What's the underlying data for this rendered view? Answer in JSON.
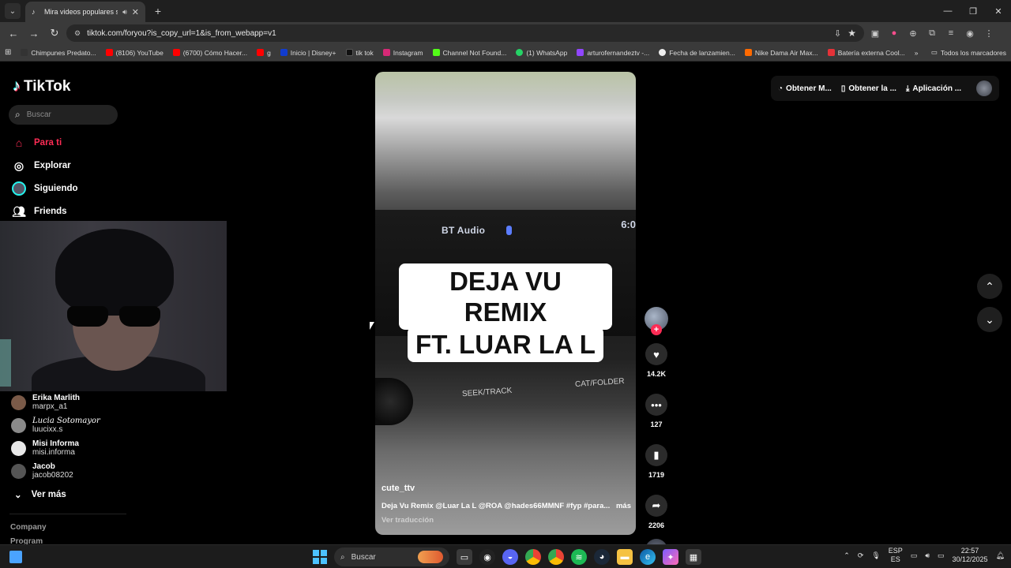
{
  "browser": {
    "tab": {
      "title": "Mira videos populares selec",
      "favicon": "tiktok-icon",
      "sound_icon": "speaker-icon"
    },
    "address": {
      "url": "tiktok.com/foryou?is_copy_url=1&is_from_webapp=v1"
    },
    "bookmarks": [
      {
        "label": "Chimpunes Predato...",
        "color": "#333333"
      },
      {
        "label": "(8106) YouTube",
        "color": "#ff0000"
      },
      {
        "label": "(6700) Cómo Hacer...",
        "color": "#ff0000"
      },
      {
        "label": "g",
        "color": "#ff0000"
      },
      {
        "label": "Inicio | Disney+",
        "color": "#113ccf"
      },
      {
        "label": "tik tok",
        "color": "#111111"
      },
      {
        "label": "Instagram",
        "color": "#d62976"
      },
      {
        "label": "Channel Not Found...",
        "color": "#53fc18"
      },
      {
        "label": "(1) WhatsApp",
        "color": "#25d366"
      },
      {
        "label": "arturofernandeztv -...",
        "color": "#9146ff"
      },
      {
        "label": "Fecha de lanzamien...",
        "color": "#eeeeee"
      },
      {
        "label": "Nike Dama Air Max...",
        "color": "#ff6a00"
      },
      {
        "label": "Batería externa Cool...",
        "color": "#e53238"
      }
    ],
    "all_bookmarks_label": "Todos los marcadores"
  },
  "sidebar": {
    "logo_text": "TikTok",
    "search_placeholder": "Buscar",
    "nav": [
      {
        "label": "Para ti",
        "icon": "home-icon",
        "active": true
      },
      {
        "label": "Explorar",
        "icon": "compass-icon",
        "active": false
      },
      {
        "label": "Siguiendo",
        "icon": "avatar-icon",
        "active": false
      },
      {
        "label": "Friends",
        "icon": "friends-icon",
        "active": false
      }
    ],
    "following": [
      {
        "name": "Erika Marlith",
        "handle": "marpx_a1"
      },
      {
        "name": "Lucia Sotomayor",
        "handle": "luucixx.s"
      },
      {
        "name": "Misi Informa",
        "handle": "misi.informa"
      },
      {
        "name": "Jacob",
        "handle": "jacob08202"
      }
    ],
    "see_more": "Ver más",
    "footer": [
      "Company",
      "Program"
    ]
  },
  "video": {
    "screen_text": {
      "bt_audio": "BT Audio",
      "clock": "6:0",
      "seek": "SEEK/TRACK",
      "cat": "CAT/FOLDER"
    },
    "caption_line1": "DEJA VU REMIX",
    "caption_line2": "FT. LUAR LA L",
    "author": "cute_ttv",
    "description": "Deja Vu Remix @Luar La L @ROA @hades66MMNF #fyp #para...",
    "more": "más",
    "translate": "Ver traducción"
  },
  "actions": {
    "likes": "14.2K",
    "comments": "127",
    "saves": "1719",
    "shares": "2206"
  },
  "topbar": {
    "btn1": "Obtener M...",
    "btn2": "Obtener la ...",
    "btn3": "Aplicación ..."
  },
  "taskbar": {
    "search_placeholder": "Buscar",
    "lang_top": "ESP",
    "lang_bottom": "ES",
    "time": "22:57",
    "date": "30/12/2025"
  }
}
